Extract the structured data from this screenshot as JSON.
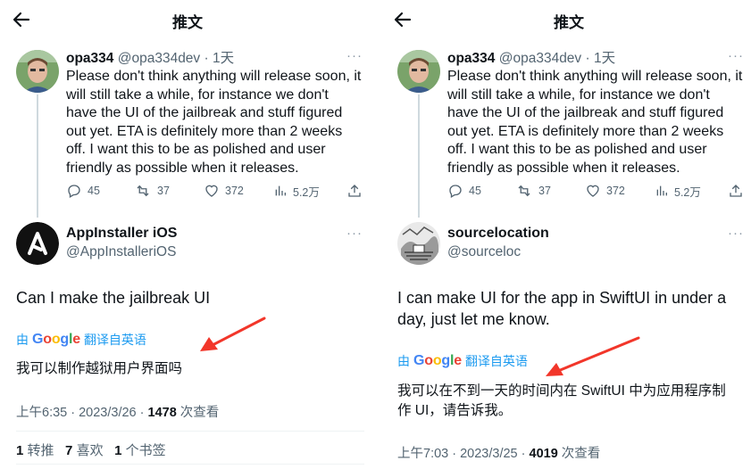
{
  "left": {
    "title": "推文",
    "quote": {
      "name": "opa334",
      "meta": "@opa334dev · 1天",
      "lines": [
        "Please don't think anything will release soon, it",
        "will still take a while, for instance we don't",
        "have the UI of the jailbreak and stuff figured",
        "out yet. ETA is definitely more than 2 weeks",
        "off. I want this to be as polished and user",
        "friendly as possible when it releases."
      ],
      "replies": "45",
      "retweets": "37",
      "likes": "372",
      "views": "5.2万"
    },
    "tweet": {
      "name": "AppInstaller iOS",
      "handle": "@AppInstalleriOS",
      "text_lines": [
        "Can I make the jailbreak UI"
      ],
      "translate_prefix": "由",
      "translate_brand": "Google",
      "translate_suffix": "翻译自英语",
      "translated_lines": [
        "我可以制作越狱用户界面吗"
      ],
      "time": "上午6:35 · 2023/3/26 · ",
      "views_count": "1478",
      "views_label": " 次查看",
      "retweets": "1",
      "retweets_label": "转推",
      "likes": "7",
      "likes_label": "喜欢",
      "bookmarks": "1",
      "bookmarks_label": "个书签"
    }
  },
  "right": {
    "title": "推文",
    "quote": {
      "name": "opa334",
      "meta": "@opa334dev · 1天",
      "lines": [
        "Please don't think anything will release soon, it",
        "will still take a while, for instance we don't",
        "have the UI of the jailbreak and stuff figured",
        "out yet. ETA is definitely more than 2 weeks",
        "off. I want this to be as polished and user",
        "friendly as possible when it releases."
      ],
      "replies": "45",
      "retweets": "37",
      "likes": "372",
      "views": "5.2万"
    },
    "tweet": {
      "name": "sourcelocation",
      "handle": "@sourceloc",
      "text_lines": [
        "I can make UI for the app in SwiftUI in under a",
        "day, just let me know."
      ],
      "translate_prefix": "由",
      "translate_brand": "Google",
      "translate_suffix": "翻译自英语",
      "translated_lines": [
        "我可以在不到一天的时间内在 SwiftUI 中为应用程序制",
        "作 UI，请告诉我。"
      ],
      "time": "上午7:03 · 2023/3/25 · ",
      "views_count": "4019",
      "views_label": " 次查看"
    }
  },
  "colors": {
    "link": "#1d9bf0",
    "secondary": "#536471",
    "arrow": "#f2362a"
  }
}
